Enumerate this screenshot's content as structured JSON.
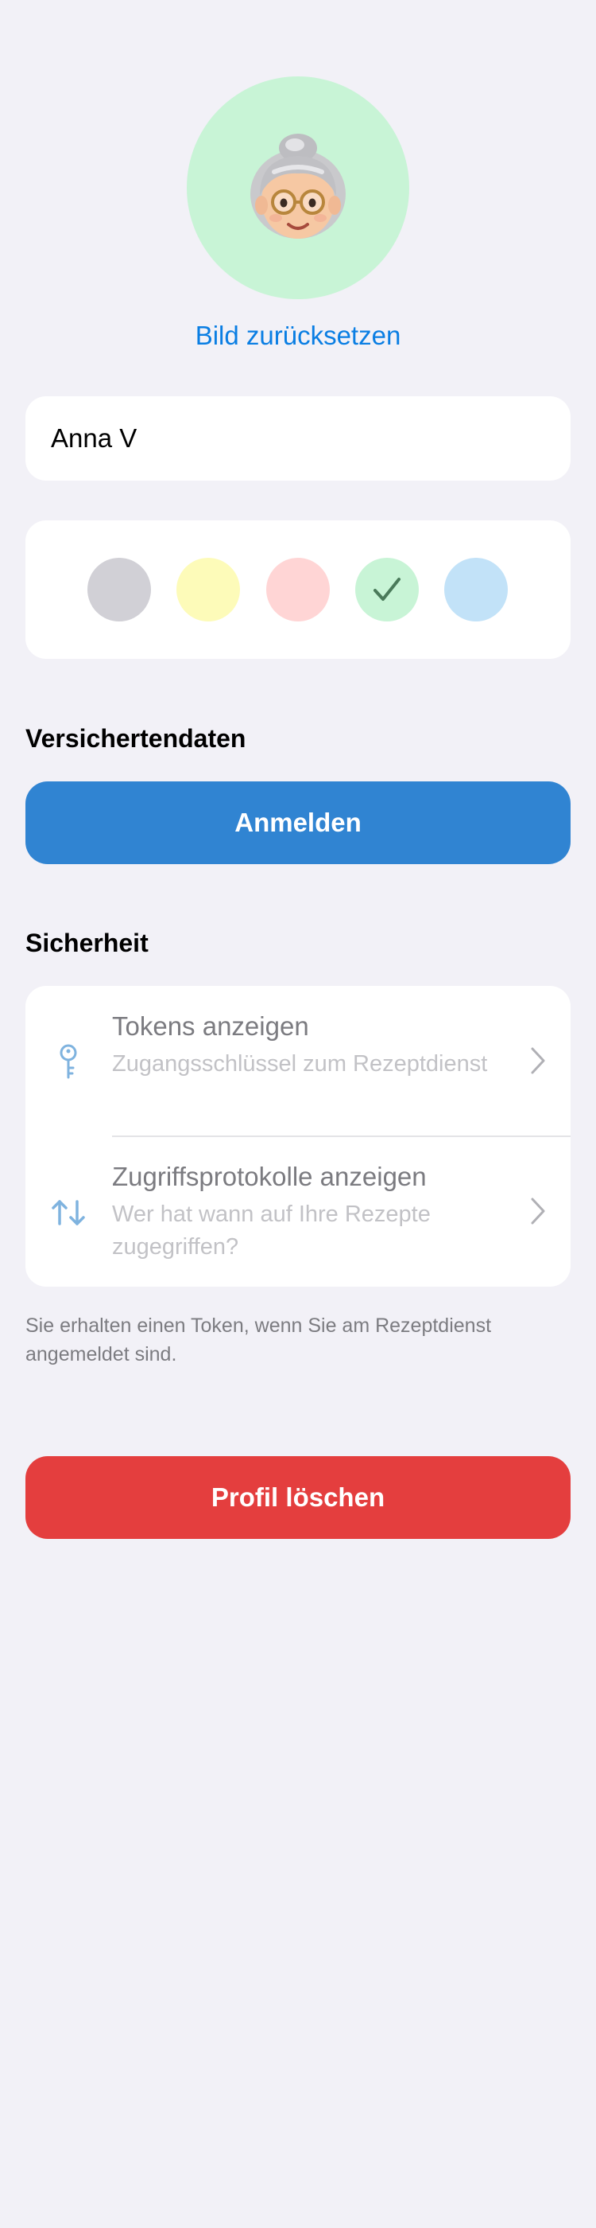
{
  "avatar": {
    "background_color": "#c8f4d6",
    "icon": "grandmother-emoji-icon",
    "reset_label": "Bild zurücksetzen"
  },
  "profile": {
    "name_value": "Anna V",
    "name_placeholder": "Name"
  },
  "colors": {
    "swatches": [
      {
        "name": "gray",
        "hex": "#d1d0d6",
        "selected": false
      },
      {
        "name": "yellow",
        "hex": "#fdfbb9",
        "selected": false
      },
      {
        "name": "red",
        "hex": "#ffd5d5",
        "selected": false
      },
      {
        "name": "green",
        "hex": "#c8f4d6",
        "selected": true
      },
      {
        "name": "blue",
        "hex": "#c2e2f8",
        "selected": false
      }
    ]
  },
  "insurance": {
    "title": "Versichertendaten",
    "login_label": "Anmelden"
  },
  "security": {
    "title": "Sicherheit",
    "items": [
      {
        "icon": "key-icon",
        "title": "Tokens anzeigen",
        "subtitle": "Zugangsschlüssel zum Rezeptdienst"
      },
      {
        "icon": "arrows-up-down-icon",
        "title": "Zugriffsprotokolle anzeigen",
        "subtitle": "Wer hat wann auf Ihre Rezepte zugegriffen?"
      }
    ],
    "footnote": "Sie erhalten einen Token, wenn Sie am Rezeptdienst angemeldet sind."
  },
  "danger": {
    "delete_label": "Profil löschen"
  },
  "theme": {
    "accent": "#0a7ee3",
    "primary_button": "#3084d2",
    "danger_button": "#e43e3e",
    "background": "#f2f1f7",
    "icon_tint": "#7fb3df"
  }
}
